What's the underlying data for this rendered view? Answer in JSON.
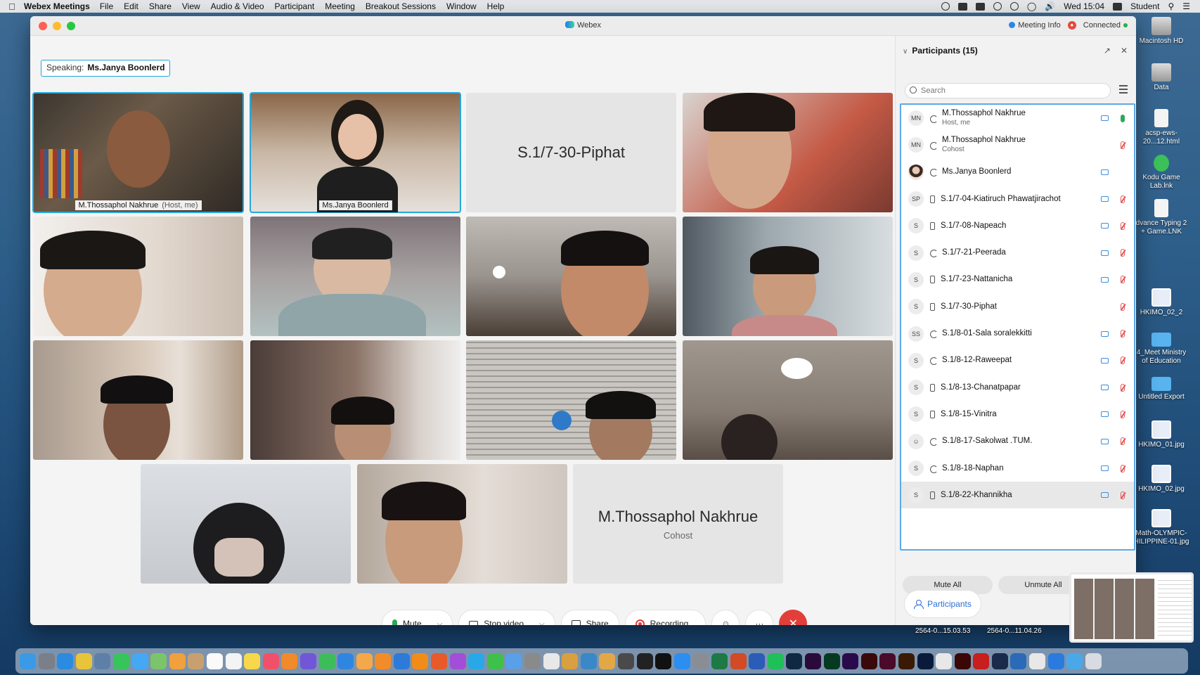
{
  "menubar": {
    "app": "Webex Meetings",
    "menus": [
      "File",
      "Edit",
      "Share",
      "View",
      "Audio & Video",
      "Participant",
      "Meeting",
      "Breakout Sessions",
      "Window",
      "Help"
    ],
    "clock": "Wed 15:04",
    "user": "Student"
  },
  "window": {
    "title": "Webex",
    "meeting_info": "Meeting Info",
    "connection": "Connected"
  },
  "speaking": {
    "label": "Speaking:",
    "name": "Ms.Janya Boonlerd"
  },
  "tiles": [
    {
      "name": "M.Thossaphol Nakhrue",
      "role": "(Host, me)"
    },
    {
      "name": "Ms.Janya Boonlerd"
    },
    {
      "big_name": "S.1/7-30-Piphat"
    },
    {
      "big_name": "M.Thossaphol Nakhrue",
      "sub": "Cohost"
    }
  ],
  "controls": {
    "mute": "Mute",
    "stop_video": "Stop video",
    "share": "Share",
    "recording": "Recording..."
  },
  "panel": {
    "title": "Participants (15)",
    "search_placeholder": "Search",
    "mute_all": "Mute All",
    "unmute_all": "Unmute All",
    "participants_tab": "Participants",
    "participants": [
      {
        "initials": "MN",
        "name": "M.Thossaphol Nakhrue",
        "sub": "Host, me",
        "mic": "on"
      },
      {
        "initials": "MN",
        "name": "M.Thossaphol Nakhrue",
        "sub": "Cohost",
        "mic": "off"
      },
      {
        "initials": "",
        "name": "Ms.Janya Boonlerd",
        "sub": "",
        "mic": "none"
      },
      {
        "initials": "SP",
        "name": "S.1/7-04-Kiatiruch Phawatjirachot",
        "sub": "",
        "mic": "off"
      },
      {
        "initials": "S",
        "name": "S.1/7-08-Napeach",
        "sub": "",
        "mic": "off"
      },
      {
        "initials": "S",
        "name": "S.1/7-21-Peerada",
        "sub": "",
        "mic": "off"
      },
      {
        "initials": "S",
        "name": "S.1/7-23-Nattanicha",
        "sub": "",
        "mic": "off"
      },
      {
        "initials": "S",
        "name": "S.1/7-30-Piphat",
        "sub": "",
        "mic": "off"
      },
      {
        "initials": "SS",
        "name": "S.1/8-01-Sala soralekkitti",
        "sub": "",
        "mic": "off"
      },
      {
        "initials": "S",
        "name": "S.1/8-12-Raweepat",
        "sub": "",
        "mic": "off"
      },
      {
        "initials": "S",
        "name": "S.1/8-13-Chanatpapar",
        "sub": "",
        "mic": "off"
      },
      {
        "initials": "S",
        "name": "S.1/8-15-Vinitra",
        "sub": "",
        "mic": "off"
      },
      {
        "initials": "",
        "name": "S.1/8-17-Sakolwat .TUM.",
        "sub": "",
        "mic": "off"
      },
      {
        "initials": "S",
        "name": "S.1/8-18-Naphan",
        "sub": "",
        "mic": "off"
      },
      {
        "initials": "S",
        "name": "S.1/8-22-Khannikha",
        "sub": "",
        "mic": "off"
      }
    ]
  },
  "desktop": [
    "Macintosh HD",
    "Data",
    "acsp-ews-20...12.html",
    "Kodu Game Lab.lnk",
    "dvance Typing 2 + Game.LNK",
    "HKIMO_02_2",
    "4_Meet Ministry of Education",
    "Untitled Export",
    "HKIMO_01.jpg",
    "HKIMO_02.jpg",
    "Math-OLYMPIC-HILIPPINE-01.jpg"
  ],
  "screenshots": [
    "2564-0...15.03.53",
    "2564-0...11.04.26"
  ]
}
